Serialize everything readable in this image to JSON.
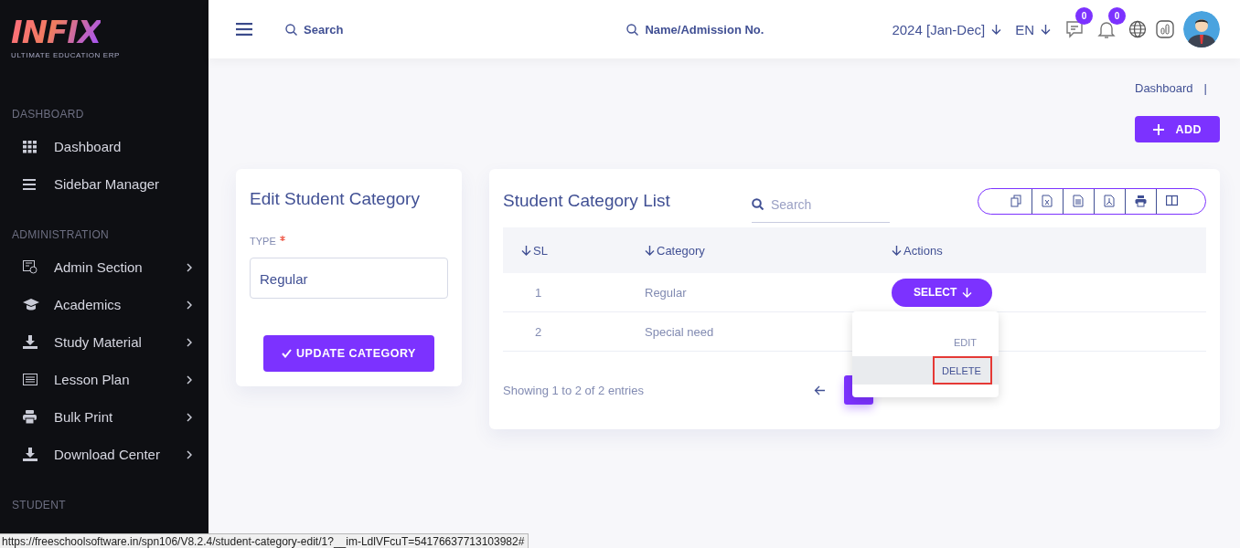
{
  "logo": {
    "name": "INFIX",
    "tagline": "ULTIMATE EDUCATION ERP"
  },
  "sidebar": {
    "sections": [
      {
        "title": "DASHBOARD",
        "items": [
          {
            "label": "Dashboard",
            "expandable": false
          },
          {
            "label": "Sidebar Manager",
            "expandable": false
          }
        ]
      },
      {
        "title": "ADMINISTRATION",
        "items": [
          {
            "label": "Admin Section",
            "expandable": true
          },
          {
            "label": "Academics",
            "expandable": true
          },
          {
            "label": "Study Material",
            "expandable": true
          },
          {
            "label": "Lesson Plan",
            "expandable": true
          },
          {
            "label": "Bulk Print",
            "expandable": true
          },
          {
            "label": "Download Center",
            "expandable": true
          }
        ]
      },
      {
        "title": "STUDENT"
      }
    ]
  },
  "header": {
    "search": {
      "placeholder": "Search"
    },
    "student_search": {
      "placeholder": "Name/Admission No."
    },
    "academic_year": "2024 [Jan-Dec]",
    "language": "EN",
    "messages_count": "0",
    "notifications_count": "0"
  },
  "breadcrumb": {
    "items": [
      "Dashboard"
    ],
    "separator": "|"
  },
  "add_button": "ADD",
  "edit_form": {
    "title": "Edit Student Category",
    "field": {
      "label": "TYPE",
      "required": true,
      "value": "Regular"
    },
    "submit": "UPDATE CATEGORY"
  },
  "list": {
    "title": "Student Category List",
    "search": {
      "placeholder": "Search"
    },
    "columns": [
      "SL",
      "Category",
      "Actions"
    ],
    "rows": [
      {
        "sl": "1",
        "category": "Regular",
        "action": "SELECT"
      },
      {
        "sl": "2",
        "category": "Special need"
      }
    ],
    "menu": {
      "items": [
        {
          "label": "EDIT",
          "selected": false
        },
        {
          "label": "DELETE",
          "selected": true
        }
      ]
    },
    "info": "Showing 1 to 2 of 2 entries",
    "pages": [
      {
        "selected": true
      }
    ]
  },
  "status_url": "https://freeschoolsoftware.in/spn106/V8.2.4/student-category-edit/1?__im-LdlVFcuT=54176637713103982#"
}
